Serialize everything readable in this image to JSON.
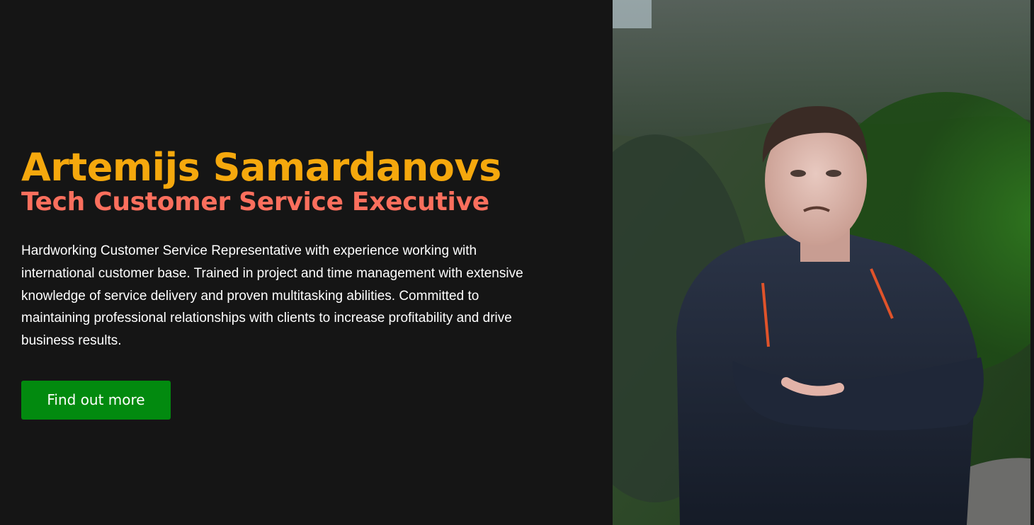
{
  "hero": {
    "name": "Artemijs Samardanovs",
    "title": "Tech Customer Service Executive",
    "summary": "Hardworking Customer Service Representative with experience working with international customer base. Trained in project and time management with extensive knowledge of service delivery and proven multitasking abilities. Committed to maintaining professional relationships with clients to increase profitability and drive business results.",
    "cta_label": "Find out more"
  },
  "colors": {
    "background": "#151515",
    "name": "#f5a80d",
    "title": "#fb6f5d",
    "text": "#ffffff",
    "button": "#028a0f"
  },
  "photo": {
    "subject": "portrait-photo"
  }
}
